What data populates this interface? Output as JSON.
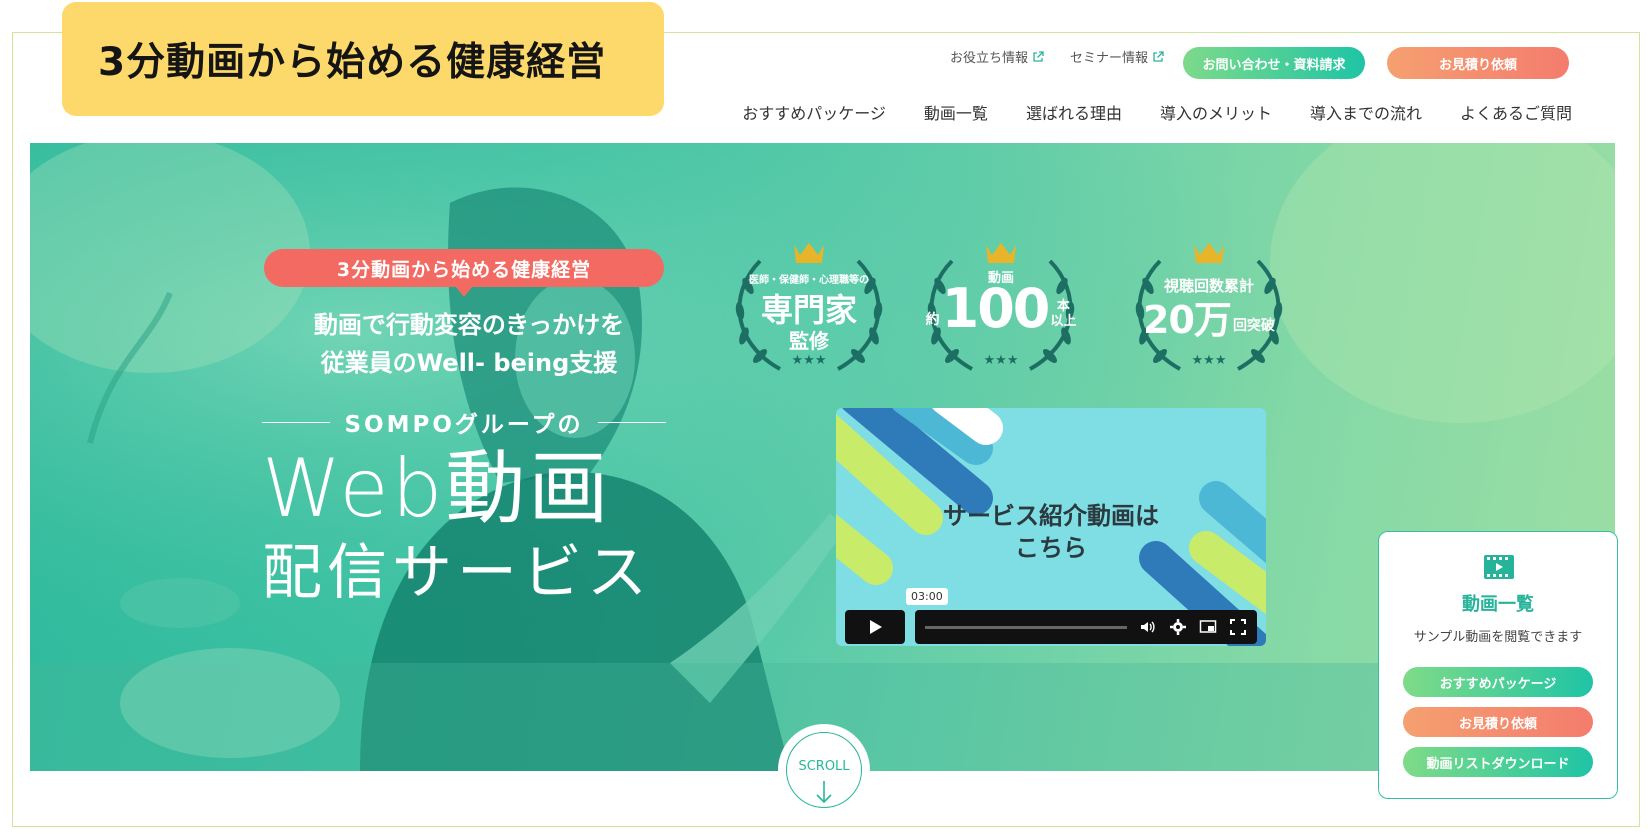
{
  "title_badge": "3分動画から始める健康経営",
  "header": {
    "util_links": [
      "お役立ち情報",
      "セミナー情報"
    ],
    "contact_button": "お問い合わせ・資料請求",
    "estimate_button": "お見積り依頼",
    "nav": [
      "おすすめパッケージ",
      "動画一覧",
      "選ばれる理由",
      "導入のメリット",
      "導入までの流れ",
      "よくあるご質問"
    ]
  },
  "hero": {
    "ribbon": "3分動画から始める健康経営",
    "tagline_1": "動画で行動変容のきっかけを",
    "tagline_2": "従業員のWell- being支援",
    "brand": "SOMPOグループの",
    "service_1": "Web動画",
    "service_2": "配信サービス"
  },
  "awards": [
    {
      "top": "医師・保健師・心理職等の",
      "main": "専門家",
      "bottom": "監修",
      "stars": "★★★"
    },
    {
      "top": "動画",
      "prefix": "約",
      "main": "100",
      "suffix_1": "本",
      "suffix_2": "以上",
      "stars": "★★★"
    },
    {
      "top": "視聴回数累計",
      "main": "20万",
      "suffix": "回突破",
      "stars": "★★★"
    }
  ],
  "video": {
    "text_1": "サービス紹介動画は",
    "text_2": "こちら",
    "duration": "03:00"
  },
  "scroll_label": "SCROLL",
  "side_panel": {
    "title": "動画一覧",
    "subtitle": "サンプル動画を閲覧できます",
    "buttons": [
      "おすすめパッケージ",
      "お見積り依頼",
      "動画リストダウンロード"
    ]
  },
  "colors": {
    "accent_green": "#25b39a",
    "accent_coral": "#f26a62",
    "badge_yellow": "#fdd86b"
  }
}
